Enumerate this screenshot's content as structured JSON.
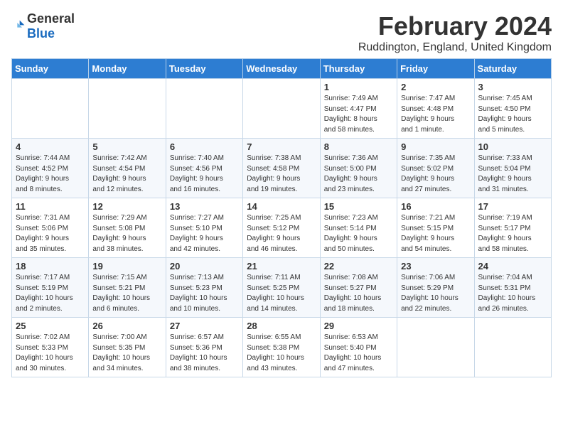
{
  "logo": {
    "general": "General",
    "blue": "Blue"
  },
  "title": {
    "month_year": "February 2024",
    "location": "Ruddington, England, United Kingdom"
  },
  "days_of_week": [
    "Sunday",
    "Monday",
    "Tuesday",
    "Wednesday",
    "Thursday",
    "Friday",
    "Saturday"
  ],
  "weeks": [
    [
      {
        "day": "",
        "info": ""
      },
      {
        "day": "",
        "info": ""
      },
      {
        "day": "",
        "info": ""
      },
      {
        "day": "",
        "info": ""
      },
      {
        "day": "1",
        "info": "Sunrise: 7:49 AM\nSunset: 4:47 PM\nDaylight: 8 hours\nand 58 minutes."
      },
      {
        "day": "2",
        "info": "Sunrise: 7:47 AM\nSunset: 4:48 PM\nDaylight: 9 hours\nand 1 minute."
      },
      {
        "day": "3",
        "info": "Sunrise: 7:45 AM\nSunset: 4:50 PM\nDaylight: 9 hours\nand 5 minutes."
      }
    ],
    [
      {
        "day": "4",
        "info": "Sunrise: 7:44 AM\nSunset: 4:52 PM\nDaylight: 9 hours\nand 8 minutes."
      },
      {
        "day": "5",
        "info": "Sunrise: 7:42 AM\nSunset: 4:54 PM\nDaylight: 9 hours\nand 12 minutes."
      },
      {
        "day": "6",
        "info": "Sunrise: 7:40 AM\nSunset: 4:56 PM\nDaylight: 9 hours\nand 16 minutes."
      },
      {
        "day": "7",
        "info": "Sunrise: 7:38 AM\nSunset: 4:58 PM\nDaylight: 9 hours\nand 19 minutes."
      },
      {
        "day": "8",
        "info": "Sunrise: 7:36 AM\nSunset: 5:00 PM\nDaylight: 9 hours\nand 23 minutes."
      },
      {
        "day": "9",
        "info": "Sunrise: 7:35 AM\nSunset: 5:02 PM\nDaylight: 9 hours\nand 27 minutes."
      },
      {
        "day": "10",
        "info": "Sunrise: 7:33 AM\nSunset: 5:04 PM\nDaylight: 9 hours\nand 31 minutes."
      }
    ],
    [
      {
        "day": "11",
        "info": "Sunrise: 7:31 AM\nSunset: 5:06 PM\nDaylight: 9 hours\nand 35 minutes."
      },
      {
        "day": "12",
        "info": "Sunrise: 7:29 AM\nSunset: 5:08 PM\nDaylight: 9 hours\nand 38 minutes."
      },
      {
        "day": "13",
        "info": "Sunrise: 7:27 AM\nSunset: 5:10 PM\nDaylight: 9 hours\nand 42 minutes."
      },
      {
        "day": "14",
        "info": "Sunrise: 7:25 AM\nSunset: 5:12 PM\nDaylight: 9 hours\nand 46 minutes."
      },
      {
        "day": "15",
        "info": "Sunrise: 7:23 AM\nSunset: 5:14 PM\nDaylight: 9 hours\nand 50 minutes."
      },
      {
        "day": "16",
        "info": "Sunrise: 7:21 AM\nSunset: 5:15 PM\nDaylight: 9 hours\nand 54 minutes."
      },
      {
        "day": "17",
        "info": "Sunrise: 7:19 AM\nSunset: 5:17 PM\nDaylight: 9 hours\nand 58 minutes."
      }
    ],
    [
      {
        "day": "18",
        "info": "Sunrise: 7:17 AM\nSunset: 5:19 PM\nDaylight: 10 hours\nand 2 minutes."
      },
      {
        "day": "19",
        "info": "Sunrise: 7:15 AM\nSunset: 5:21 PM\nDaylight: 10 hours\nand 6 minutes."
      },
      {
        "day": "20",
        "info": "Sunrise: 7:13 AM\nSunset: 5:23 PM\nDaylight: 10 hours\nand 10 minutes."
      },
      {
        "day": "21",
        "info": "Sunrise: 7:11 AM\nSunset: 5:25 PM\nDaylight: 10 hours\nand 14 minutes."
      },
      {
        "day": "22",
        "info": "Sunrise: 7:08 AM\nSunset: 5:27 PM\nDaylight: 10 hours\nand 18 minutes."
      },
      {
        "day": "23",
        "info": "Sunrise: 7:06 AM\nSunset: 5:29 PM\nDaylight: 10 hours\nand 22 minutes."
      },
      {
        "day": "24",
        "info": "Sunrise: 7:04 AM\nSunset: 5:31 PM\nDaylight: 10 hours\nand 26 minutes."
      }
    ],
    [
      {
        "day": "25",
        "info": "Sunrise: 7:02 AM\nSunset: 5:33 PM\nDaylight: 10 hours\nand 30 minutes."
      },
      {
        "day": "26",
        "info": "Sunrise: 7:00 AM\nSunset: 5:35 PM\nDaylight: 10 hours\nand 34 minutes."
      },
      {
        "day": "27",
        "info": "Sunrise: 6:57 AM\nSunset: 5:36 PM\nDaylight: 10 hours\nand 38 minutes."
      },
      {
        "day": "28",
        "info": "Sunrise: 6:55 AM\nSunset: 5:38 PM\nDaylight: 10 hours\nand 43 minutes."
      },
      {
        "day": "29",
        "info": "Sunrise: 6:53 AM\nSunset: 5:40 PM\nDaylight: 10 hours\nand 47 minutes."
      },
      {
        "day": "",
        "info": ""
      },
      {
        "day": "",
        "info": ""
      }
    ]
  ]
}
